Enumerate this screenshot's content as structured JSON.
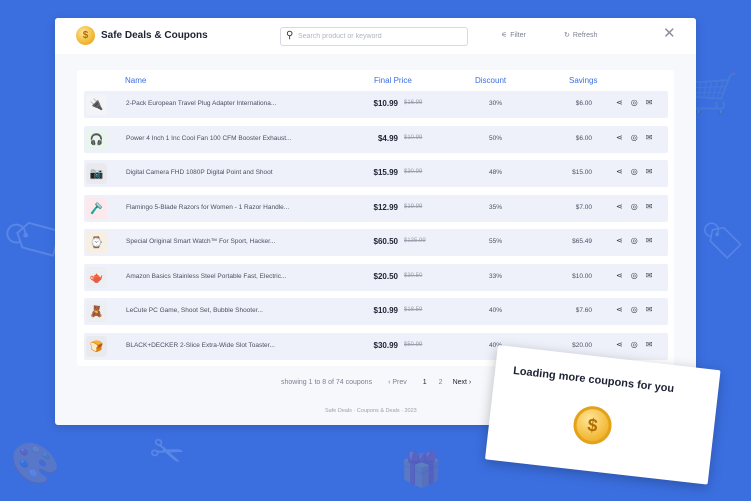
{
  "app": {
    "title": "Safe Deals & Coupons",
    "logo_glyph": "$",
    "brand_color": "#3b6fe0"
  },
  "toolbar": {
    "search_placeholder": "Search product or keyword",
    "filter_label": "Filter",
    "refresh_label": "Refresh",
    "close_glyph": "✕"
  },
  "table": {
    "headers": {
      "name": "Name",
      "final_price": "Final Price",
      "discount": "Discount",
      "savings": "Savings"
    },
    "rows": [
      {
        "icon": "plug-adapter-icon",
        "glyph": "🔌",
        "name": "2-Pack European Travel Plug Adapter Internationa...",
        "price": "$10.99",
        "orig": "$16.99",
        "discount": "30%",
        "savings": "$6.00"
      },
      {
        "icon": "neck-fan-icon",
        "glyph": "🎧",
        "name": "Power 4 Inch 1 Inc Cool Fan 100 CFM Booster Exhaust...",
        "price": "$4.99",
        "orig": "$10.99",
        "discount": "50%",
        "savings": "$6.00"
      },
      {
        "icon": "camera-icon",
        "glyph": "📷",
        "name": "Digital Camera FHD 1080P Digital Point and Shoot",
        "price": "$15.99",
        "orig": "$30.99",
        "discount": "48%",
        "savings": "$15.00"
      },
      {
        "icon": "razor-icon",
        "glyph": "🪒",
        "name": "Flamingo 5-Blade Razors for Women - 1 Razor Handle...",
        "price": "$12.99",
        "orig": "$19.99",
        "discount": "35%",
        "savings": "$7.00"
      },
      {
        "icon": "watch-icon",
        "glyph": "⌚",
        "name": "Special Original Smart Watch™ For Sport, Hacker...",
        "price": "$60.50",
        "orig": "$135.99",
        "discount": "55%",
        "savings": "$65.49"
      },
      {
        "icon": "kettle-icon",
        "glyph": "🫖",
        "name": "Amazon Basics Stainless Steel Portable Fast, Electric...",
        "price": "$20.50",
        "orig": "$30.50",
        "discount": "33%",
        "savings": "$10.00"
      },
      {
        "icon": "toy-icon",
        "glyph": "🧸",
        "name": "LeCute PC Game, Shoot Set, Bubble Shooter...",
        "price": "$10.99",
        "orig": "$18.59",
        "discount": "40%",
        "savings": "$7.60"
      },
      {
        "icon": "toaster-icon",
        "glyph": "🍞",
        "name": "BLACK+DECKER 2-Slice Extra-Wide Slot Toaster...",
        "price": "$30.99",
        "orig": "$50.99",
        "discount": "40%",
        "savings": "$20.00"
      }
    ]
  },
  "pagination": {
    "summary": "showing 1 to 8 of 74 coupons",
    "prev": "‹ Prev",
    "page1": "1",
    "page2": "2",
    "next": "Next ›"
  },
  "footer": "Safe Deals · Coupons & Deals · 2023",
  "overlay": {
    "text": "Loading more coupons for you",
    "coin_glyph": "$"
  }
}
